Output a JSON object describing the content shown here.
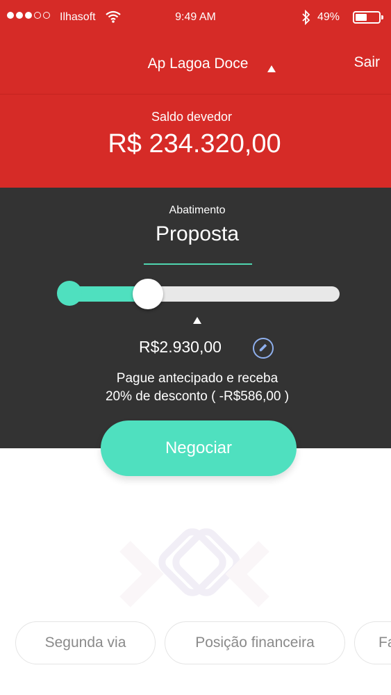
{
  "status_bar": {
    "carrier": "Ilhasoft",
    "time": "9:49 AM",
    "battery": "49%",
    "battery_level": 0.49
  },
  "header": {
    "title": "Ap Lagoa Doce",
    "logout_label": "Sair"
  },
  "balance": {
    "label": "Saldo devedor",
    "amount": "R$ 234.320,00"
  },
  "abatimento": {
    "label": "Abatimento",
    "mode": "Proposta",
    "slider_fraction": 0.32,
    "value": "R$2.930,00",
    "message_line1": "Pague antecipado e receba",
    "message_line2": "20% de desconto ( -R$586,00 )"
  },
  "actions": {
    "negotiate_label": "Negociar"
  },
  "quick_links": [
    {
      "label": "Segunda via"
    },
    {
      "label": "Posição financeira"
    },
    {
      "label": "Fa"
    }
  ],
  "colors": {
    "brand_red": "#d62b27",
    "accent_green": "#4fe0bf",
    "panel_dark": "#333333"
  },
  "icons": [
    "wifi-icon",
    "bluetooth-icon",
    "battery-icon",
    "caret-up-icon",
    "pencil-icon",
    "logo-icon"
  ]
}
